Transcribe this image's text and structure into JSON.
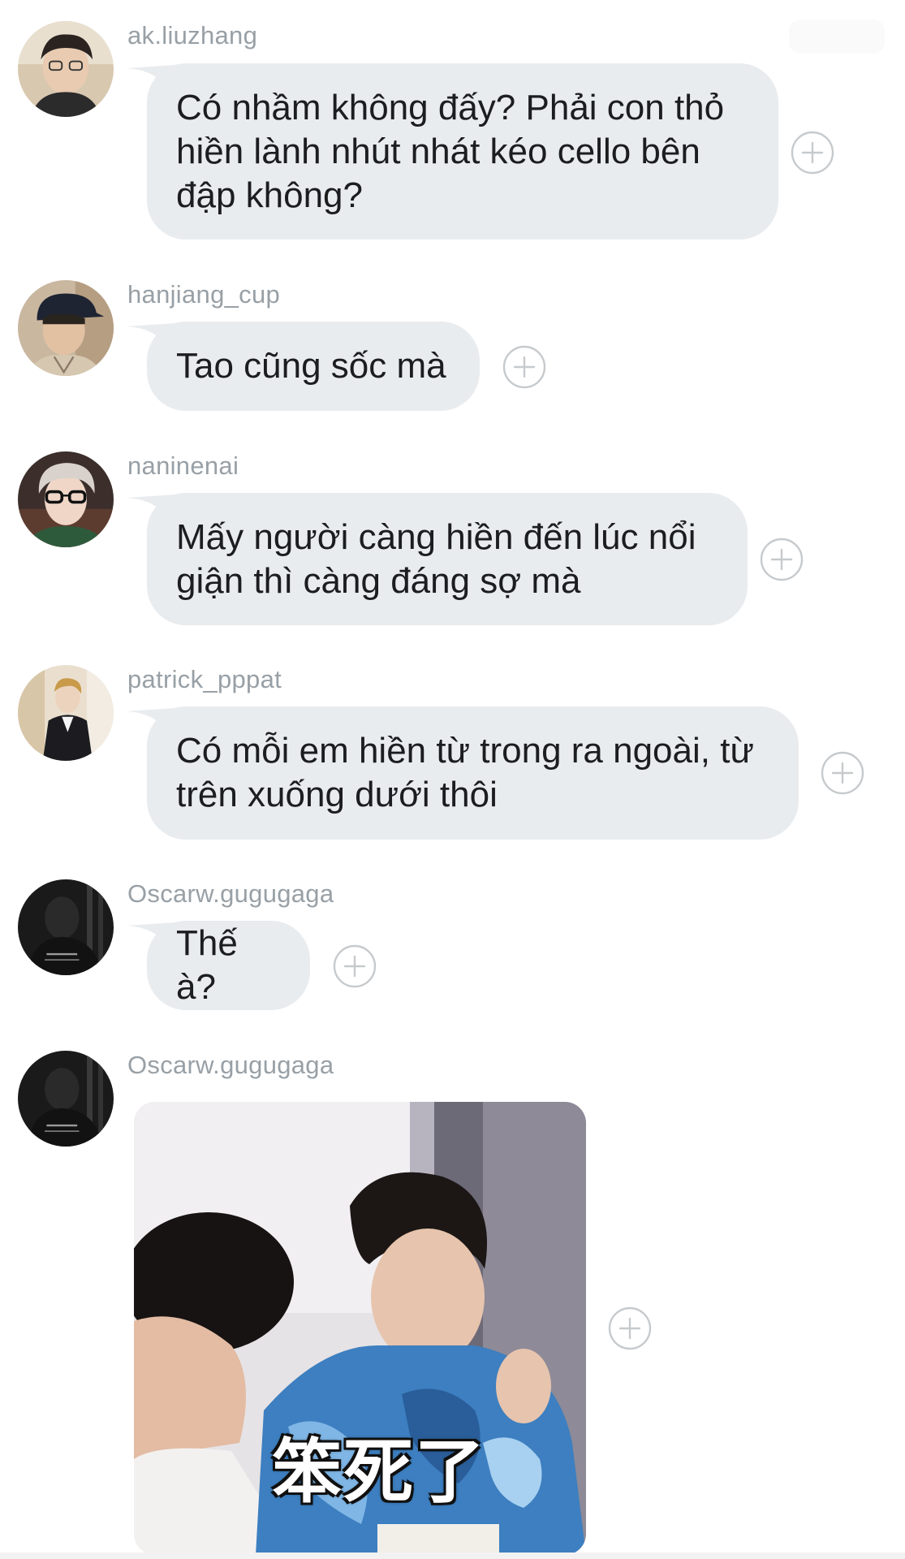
{
  "messages": [
    {
      "username": "ak.liuzhang",
      "text": "Có nhầm không đấy? Phải con thỏ hiền lành nhút nhát kéo cello bên đập không?"
    },
    {
      "username": "hanjiang_cup",
      "text": "Tao cũng sốc mà"
    },
    {
      "username": "naninenai",
      "text": "Mấy người càng hiền đến lúc nổi giận thì càng đáng sợ mà"
    },
    {
      "username": "patrick_pppat",
      "text": "Có mỗi em hiền từ trong ra ngoài, từ trên xuống dưới thôi"
    },
    {
      "username": "Oscarw.gugugaga",
      "text": "Thế à?"
    },
    {
      "username": "Oscarw.gugugaga",
      "sticker_caption": "笨死了"
    }
  ],
  "icons": {
    "react": "plus-circle-icon"
  },
  "colors": {
    "bubble": "#e9ecef",
    "username": "#98a0a6",
    "text": "#1b1d1f",
    "icon": "#c6cacd"
  }
}
